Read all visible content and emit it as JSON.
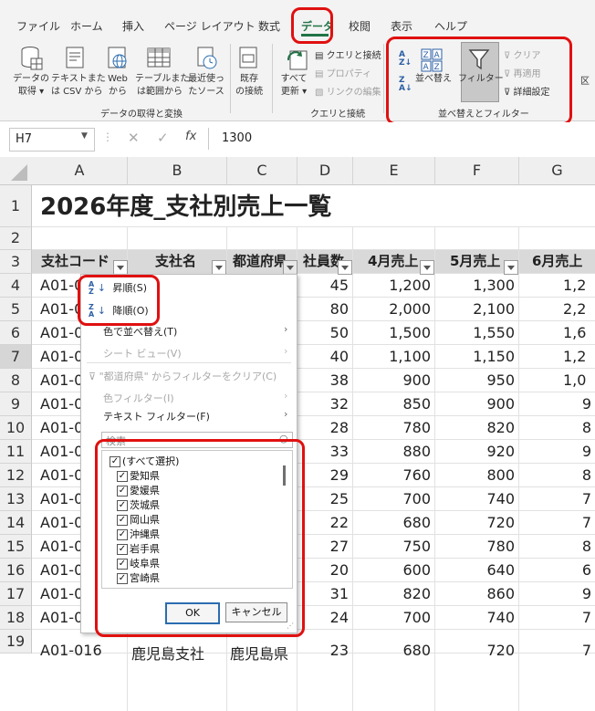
{
  "ribbon_tabs": [
    "ファイル",
    "ホーム",
    "挿入",
    "ページ レイアウト",
    "数式",
    "データ",
    "校閲",
    "表示",
    "ヘルプ"
  ],
  "active_tab": "データ",
  "ribbon": {
    "get_data": {
      "line1": "データの",
      "line2": "取得 ▾"
    },
    "from_csv": {
      "line1": "テキストまた",
      "line2": "は CSV から"
    },
    "from_web": {
      "line1": "Web",
      "line2": "から"
    },
    "from_table": {
      "line1": "テーブルまた",
      "line2": "は範囲から"
    },
    "recent_sources": {
      "line1": "最近使っ",
      "line2": "たソース"
    },
    "existing_conn": {
      "line1": "既存",
      "line2": "の接続"
    },
    "group_get_transform": "データの取得と変換",
    "refresh_all": {
      "line1": "すべて",
      "line2": "更新 ▾"
    },
    "queries_connections": "クエリと接続",
    "properties": "プロパティ",
    "edit_links": "リンクの編集",
    "group_queries": "クエリと接続",
    "sort": "並べ替え",
    "filter": "フィルター",
    "clear": "クリア",
    "reapply": "再適用",
    "advanced": "詳細設定",
    "group_sort_filter": "並べ替えとフィルター",
    "cut_label": "区"
  },
  "formula_bar": {
    "name_box": "H7",
    "fx": "fx",
    "value": "1300"
  },
  "columns": [
    "A",
    "B",
    "C",
    "D",
    "E",
    "F",
    "G"
  ],
  "rows": [
    "1",
    "2",
    "3",
    "4",
    "5",
    "6",
    "7",
    "8",
    "9",
    "10",
    "11",
    "12",
    "13",
    "14",
    "15",
    "16",
    "17",
    "18",
    "19"
  ],
  "title": "2026年度_支社別売上一覧",
  "headers": [
    "支社コード",
    "支社名",
    "都道府県",
    "社員数",
    "4月売上",
    "5月売上",
    "6月売上"
  ],
  "table": [
    [
      "A01-0",
      "45",
      "1,200",
      "1,300",
      "1,2"
    ],
    [
      "A01-0",
      "80",
      "2,000",
      "2,100",
      "2,2"
    ],
    [
      "A01-0",
      "50",
      "1,500",
      "1,550",
      "1,6"
    ],
    [
      "A01-0",
      "40",
      "1,100",
      "1,150",
      "1,2"
    ],
    [
      "A01-0",
      "38",
      "900",
      "950",
      "1,0"
    ],
    [
      "A01-0",
      "32",
      "850",
      "900",
      "9"
    ],
    [
      "A01-0",
      "28",
      "780",
      "820",
      "8"
    ],
    [
      "A01-0",
      "33",
      "880",
      "920",
      "9"
    ],
    [
      "A01-0",
      "29",
      "760",
      "800",
      "8"
    ],
    [
      "A01-0",
      "25",
      "700",
      "740",
      "7"
    ],
    [
      "A01-0",
      "22",
      "680",
      "720",
      "7"
    ],
    [
      "A01-0",
      "27",
      "750",
      "780",
      "8"
    ],
    [
      "A01-0",
      "20",
      "600",
      "640",
      "6"
    ],
    [
      "A01-0",
      "31",
      "820",
      "860",
      "9"
    ],
    [
      "A01-0",
      "24",
      "700",
      "740",
      "7"
    ]
  ],
  "last_row": {
    "code": "A01-016",
    "name": "鹿児島支社",
    "pref": "鹿児島県",
    "emp": "23",
    "apr": "680",
    "may": "720",
    "jun": "7"
  },
  "filter_menu": {
    "sort_asc": "昇順(S)",
    "sort_desc": "降順(O)",
    "sort_by_color": "色で並べ替え(T)",
    "sheet_view": "シート ビュー(V)",
    "clear_filter": "\"都道府県\" からフィルターをクリア(C)",
    "color_filter": "色フィルター(I)",
    "text_filter": "テキスト フィルター(F)",
    "search_placeholder": "検索",
    "items": [
      "(すべて選択)",
      "愛知県",
      "愛媛県",
      "茨城県",
      "岡山県",
      "沖縄県",
      "岩手県",
      "岐阜県",
      "宮崎県"
    ],
    "ok": "OK",
    "cancel": "キャンセル"
  },
  "colors": {
    "accent": "#217346",
    "highlight": "#e01010",
    "header_fill": "#d9d9d9"
  }
}
